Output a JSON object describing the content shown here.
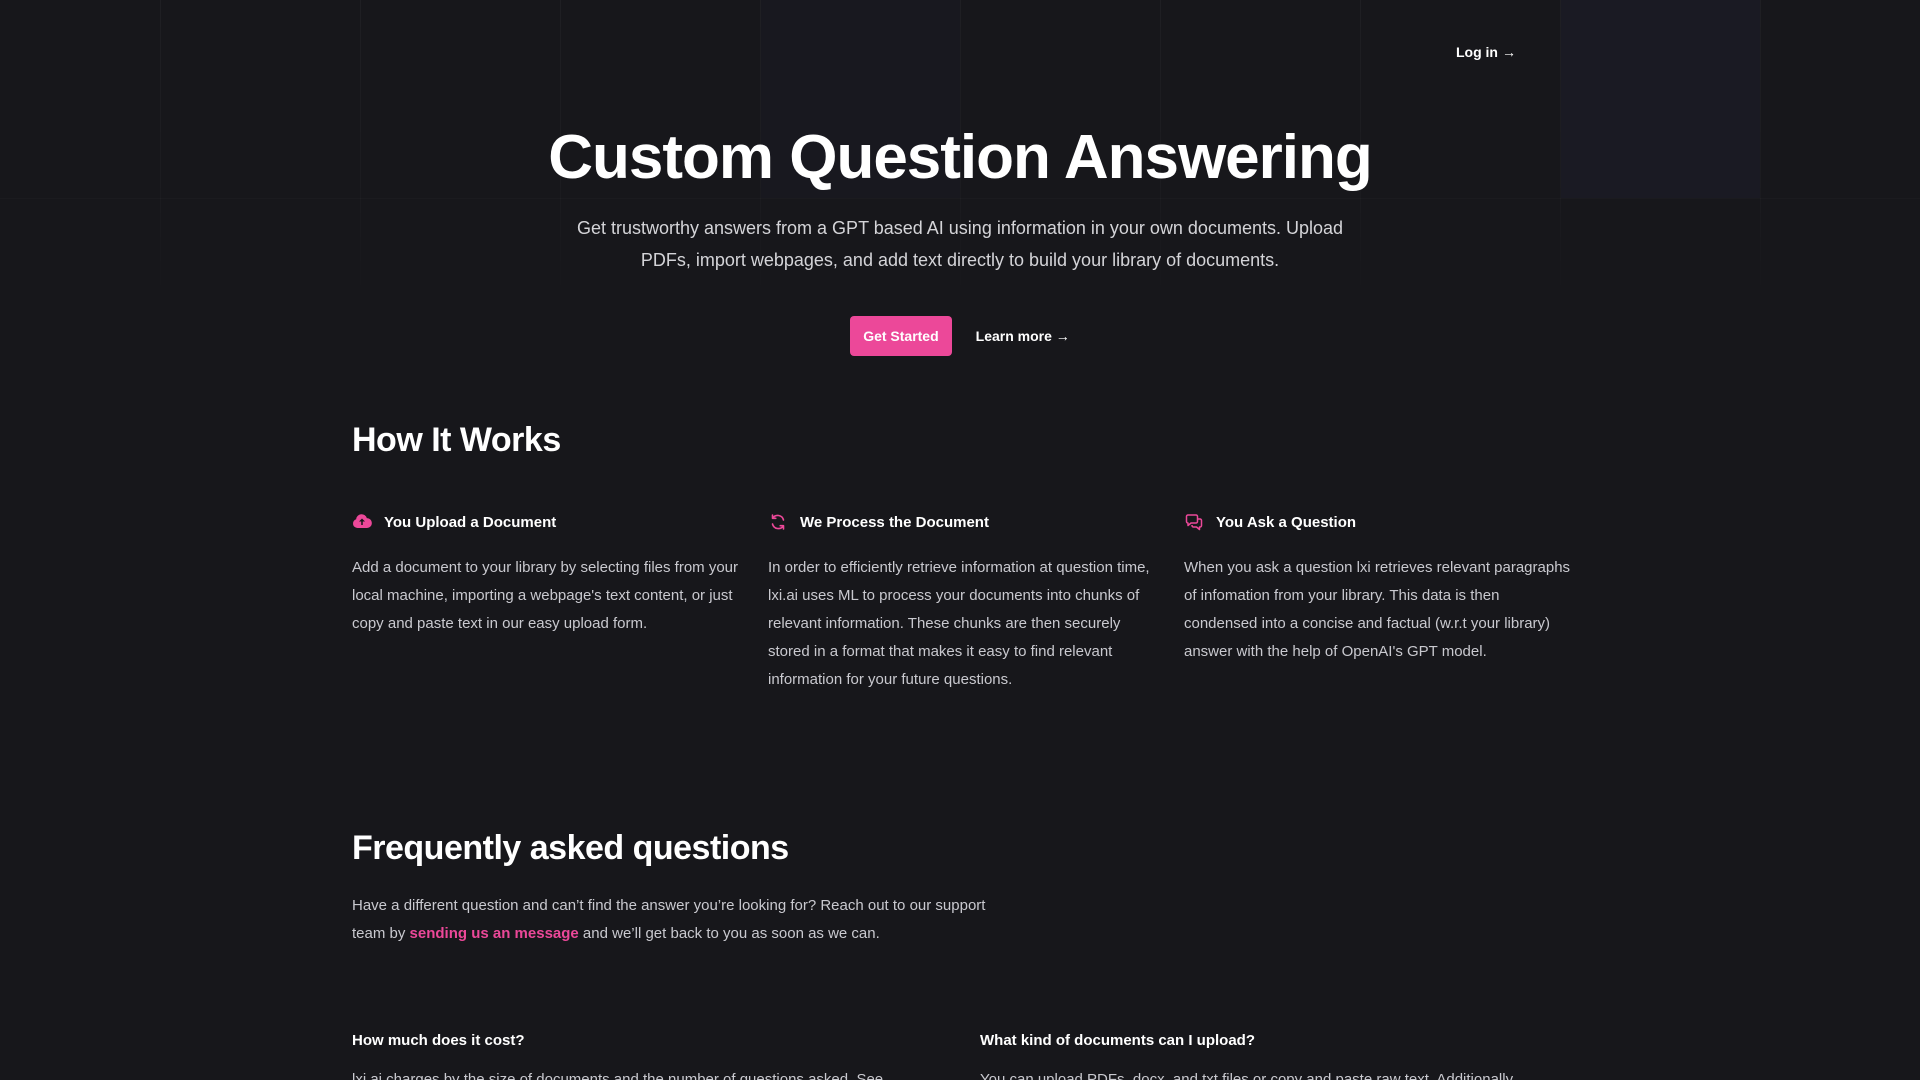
{
  "nav": {
    "login_label": "Log in",
    "login_arrow": "→"
  },
  "hero": {
    "title": "Custom Question Answering",
    "subtitle": "Get trustworthy answers from a GPT based AI using information in your own documents. Upload PDFs, import webpages, and add text directly to build your library of documents.",
    "primary_button": "Get Started",
    "secondary_link": "Learn more",
    "secondary_arrow": "→"
  },
  "how_it_works": {
    "title": "How It Works",
    "features": [
      {
        "icon": "cloud-upload-icon",
        "title": "You Upload a Document",
        "text": "Add a document to your library by selecting files from your local machine, importing a webpage's text content, or just copy and paste text in our easy upload form."
      },
      {
        "icon": "refresh-icon",
        "title": "We Process the Document",
        "text": "In order to efficiently retrieve information at question time, lxi.ai uses ML to process your documents into chunks of relevant information. These chunks are then securely stored in a format that makes it easy to find relevant information for your future questions."
      },
      {
        "icon": "chat-bubbles-icon",
        "title": "You Ask a Question",
        "text": "When you ask a question lxi retrieves relevant paragraphs of infomation from your library. This data is then condensed into a concise and factual (w.r.t your library) answer with the help of OpenAI's GPT model."
      }
    ]
  },
  "faq": {
    "title": "Frequently asked questions",
    "intro_before": "Have a different question and can’t find the answer you’re looking for? Reach out to our support team by ",
    "intro_link": "sending us an message",
    "intro_after": " and we’ll get back to you as soon as we can.",
    "items": [
      {
        "question": "How much does it cost?",
        "answer": "lxi.ai charges by the size of documents and the number of questions asked. See"
      },
      {
        "question": "What kind of documents can I upload?",
        "answer": "You can upload PDFs, docx, and txt files or copy and paste raw text. Additionally"
      }
    ]
  },
  "colors": {
    "background": "#17171b",
    "accent": "#ec4899",
    "body_text": "#c9c9cf"
  }
}
